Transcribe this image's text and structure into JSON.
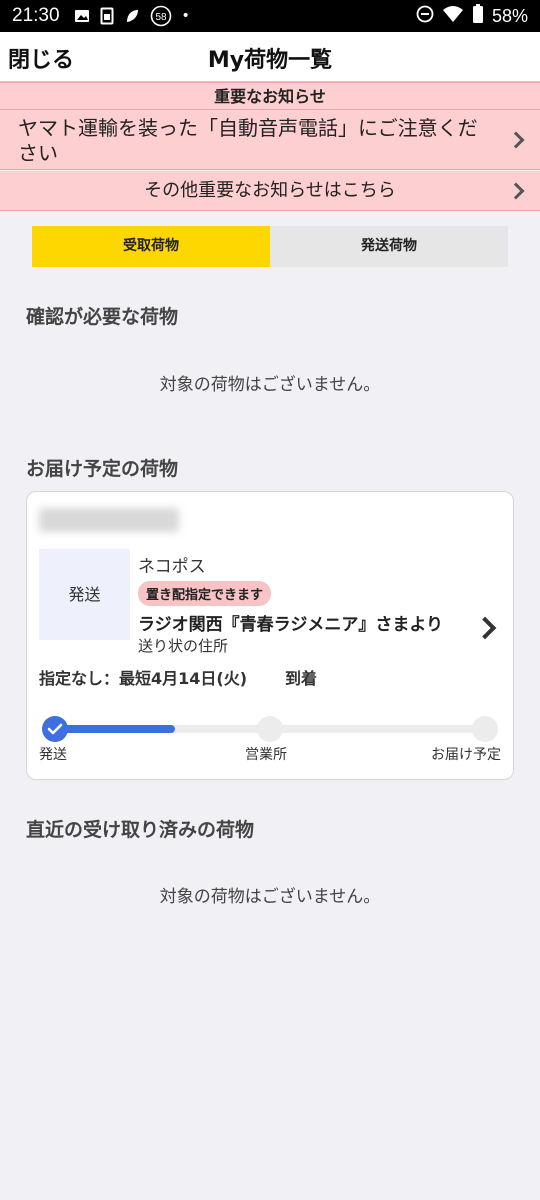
{
  "status_bar": {
    "time": "21:30",
    "notification_count": "58",
    "battery": "58%"
  },
  "header": {
    "close_label": "閉じる",
    "title": "My荷物一覧"
  },
  "notices": {
    "heading": "重要なお知らせ",
    "main_notice": "ヤマト運輸を装った「自動音声電話」にご注意ください",
    "other_notices": "その他重要なお知らせはこちら"
  },
  "tabs": {
    "receive": "受取荷物",
    "send": "発送荷物"
  },
  "sections": {
    "needs_confirmation": {
      "title": "確認が必要な荷物",
      "empty": "対象の荷物はございません。"
    },
    "scheduled": {
      "title": "お届け予定の荷物"
    },
    "recent": {
      "title": "直近の受け取り済みの荷物",
      "empty": "対象の荷物はございません。"
    }
  },
  "package": {
    "thumbnail_label": "発送",
    "service": "ネコポス",
    "badge": "置き配指定できます",
    "sender": "ラジオ関西『青春ラジメニア』さまより",
    "address": "送り状の住所",
    "eta": "指定なし：最短4月14日(火)",
    "eta_suffix": "到着",
    "progress": 0.28,
    "steps": [
      "発送",
      "営業所",
      "お届け予定"
    ]
  },
  "colors": {
    "accent_yellow": "#ffd700",
    "notice_pink": "#fdcfd0",
    "progress_blue": "#3e6fe0"
  }
}
